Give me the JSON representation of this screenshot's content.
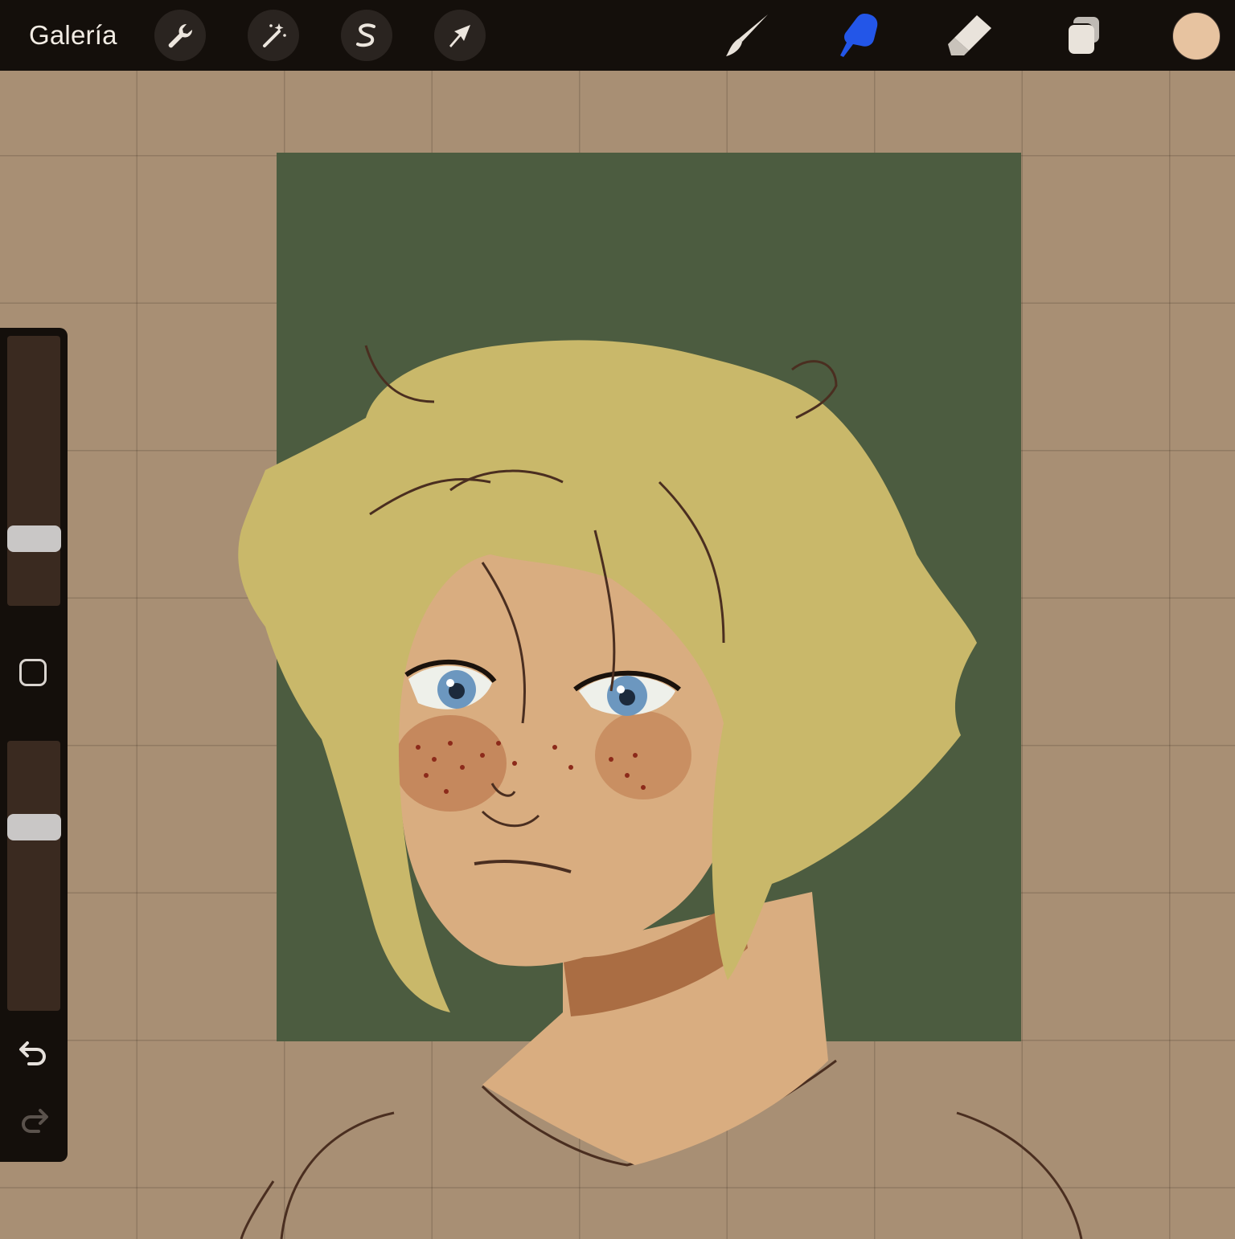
{
  "toolbar": {
    "gallery_label": "Galería",
    "left_tools": [
      "wrench-icon",
      "magic-wand-icon",
      "selection-icon",
      "transform-arrow-icon"
    ],
    "right_tools": [
      "brush-icon",
      "smudge-icon",
      "eraser-icon",
      "layers-icon"
    ],
    "active_tool": "smudge-icon",
    "active_tool_color": "#2356e8",
    "current_color": "#e7c3a0"
  },
  "sidebar": {
    "brush_size_level": 0.22,
    "opacity_level": 0.7
  },
  "canvas": {
    "paper_color": "#a88f74",
    "panel_color": "#4c5c40",
    "hair_color": "#c9b86a",
    "skin_color": "#d9ad80",
    "eye_color": "#6c97bf"
  }
}
